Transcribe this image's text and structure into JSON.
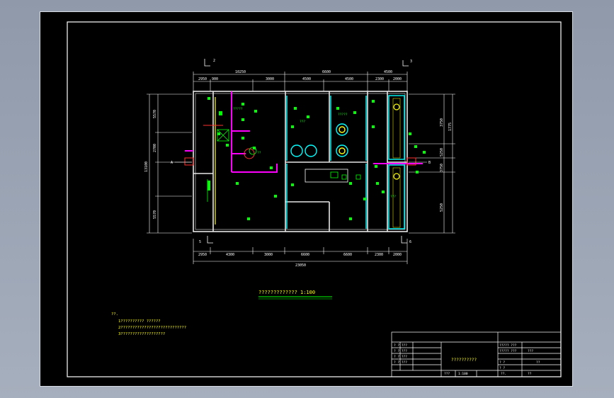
{
  "drawing": {
    "title": "????????????? 1:100",
    "notes_heading": "??.",
    "notes": [
      "1??????????  ??????",
      "2????????????????????????????",
      "3???????????????????"
    ],
    "dimensions": {
      "top_total": [
        "10250",
        "6600",
        "4500"
      ],
      "top_segments": [
        "2950",
        "900",
        "3000",
        "4500",
        "4500",
        "2300",
        "2000"
      ],
      "bottom_segments": [
        "2950",
        "4300",
        "3000",
        "6600",
        "6600",
        "2300",
        "2000"
      ],
      "bottom_total": "23050",
      "left_outer": "13100",
      "left_segments": [
        "5570",
        "2700",
        "5570"
      ],
      "right_outer": [
        "3750",
        "1775"
      ],
      "right_segments": [
        "5250",
        "3750",
        "5250"
      ]
    },
    "room_labels": {
      "office": "?????",
      "room_a": "??",
      "room_b": "?????",
      "room_c": "???",
      "room_d": "???"
    },
    "axis_markers": {
      "top_left": "2",
      "top_right": "3",
      "bottom_left": "5",
      "bottom_right": "6",
      "grid_a": "A",
      "grid_b": "B"
    },
    "title_block": {
      "project": "??????????",
      "left_rows": [
        "? ? ???",
        "? ? ???",
        "? ? ???",
        "? ? ???"
      ],
      "right_rows": [
        "????? ???",
        "????? ???",
        "?  ?",
        "?  ?"
      ],
      "right_values": [
        "???",
        "",
        "??",
        "??"
      ],
      "bottom_cells": [
        "???",
        "1:100",
        "??.",
        "??"
      ]
    },
    "colors": {
      "wall": "#e6e6e6",
      "equipment": "#00ff00",
      "duct": "#ff00ff",
      "water": "#00ffff",
      "dim": "#ffffff",
      "highlight": "#ffff00",
      "red": "#ff3030"
    }
  }
}
